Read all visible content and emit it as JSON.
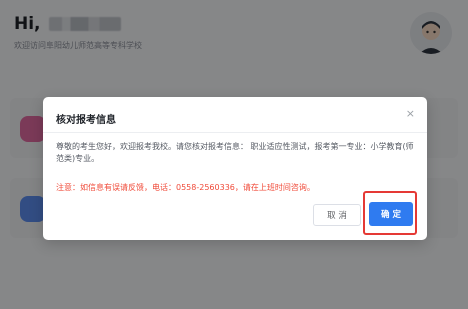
{
  "header": {
    "greeting": "Hi,",
    "welcome": "欢迎访问阜阳幼儿师范高等专科学校"
  },
  "dialog": {
    "title": "核对报考信息",
    "close_icon": "×",
    "message": "尊敬的考生您好，欢迎报考我校。请您核对报考信息： 职业适应性测试，报考第一专业：小学教育(师范类)专业。",
    "notice": "注意：如信息有误请反馈，电话：0558-2560336，请在上班时间咨询。",
    "cancel_label": "取 消",
    "confirm_label": "确 定"
  },
  "colors": {
    "primary": "#2f7bf0",
    "notice": "#f04b3a",
    "highlight": "#e53935"
  }
}
